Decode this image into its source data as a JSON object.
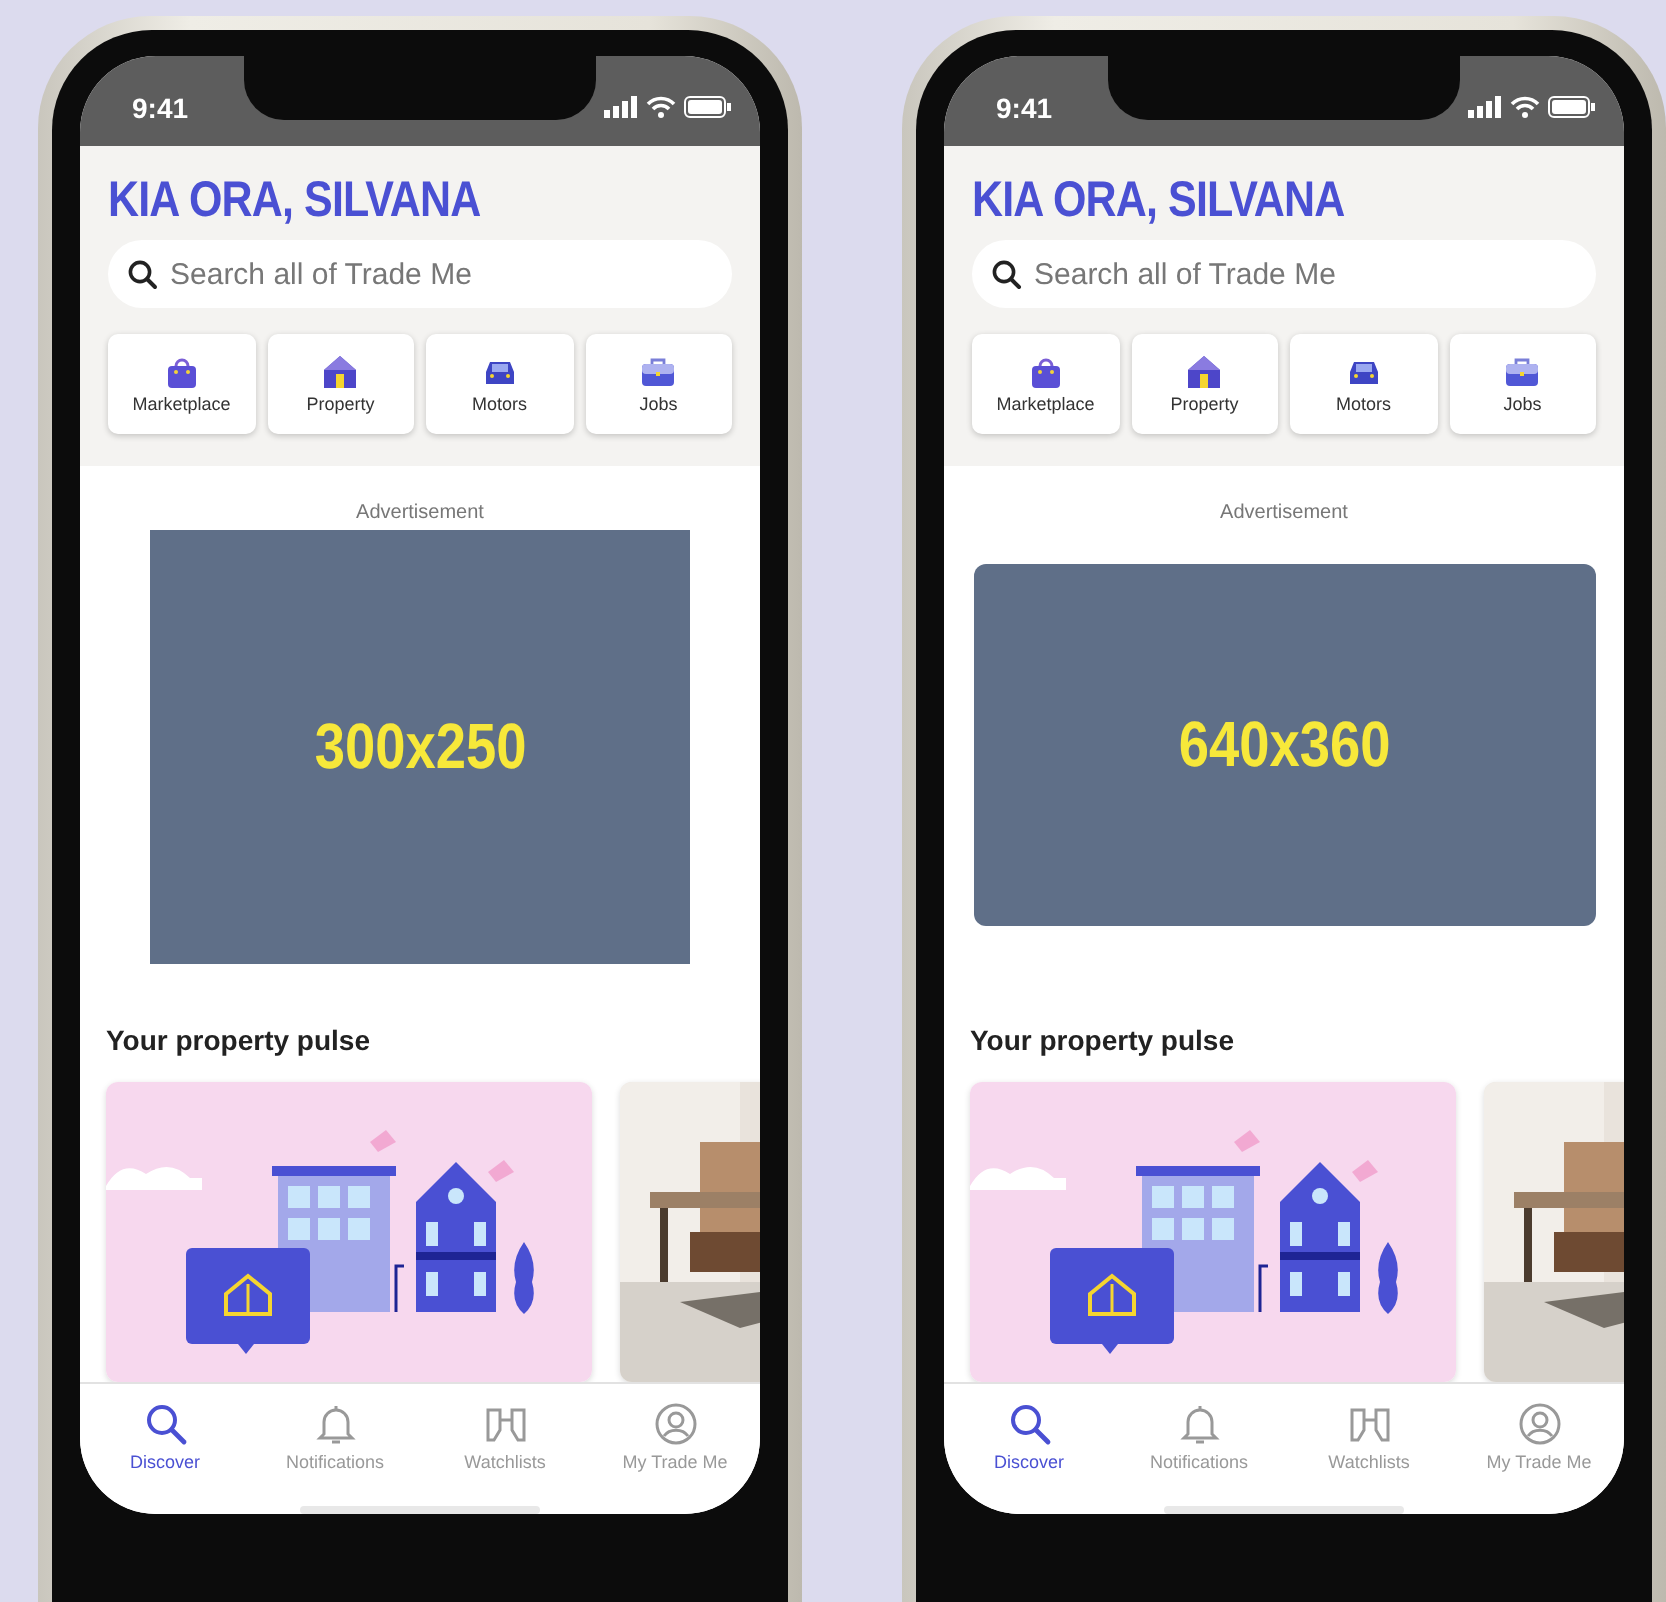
{
  "phones": [
    {
      "status_bar": {
        "time": "9:41"
      },
      "greeting": "KIA ORA, SILVANA",
      "search": {
        "placeholder": "Search all of Trade Me"
      },
      "categories": [
        {
          "label": "Marketplace",
          "kind": "bag"
        },
        {
          "label": "Property",
          "kind": "house"
        },
        {
          "label": "Motors",
          "kind": "car"
        },
        {
          "label": "Jobs",
          "kind": "briefcase"
        }
      ],
      "advert": {
        "label": "Advertisement",
        "size": "300x250",
        "kind": "square"
      },
      "section_title": "Your property pulse",
      "cards": [
        {
          "kind": "illustration"
        },
        {
          "kind": "picture"
        }
      ],
      "nav": [
        {
          "label": "Discover",
          "kind": "search",
          "selected": true
        },
        {
          "label": "Notifications",
          "kind": "bell",
          "selected": false
        },
        {
          "label": "Watchlists",
          "kind": "binoculars",
          "selected": false
        },
        {
          "label": "My Trade Me",
          "kind": "person",
          "selected": false
        }
      ]
    },
    {
      "status_bar": {
        "time": "9:41"
      },
      "greeting": "KIA ORA, SILVANA",
      "search": {
        "placeholder": "Search all of Trade Me"
      },
      "categories": [
        {
          "label": "Marketplace",
          "kind": "bag"
        },
        {
          "label": "Property",
          "kind": "house"
        },
        {
          "label": "Motors",
          "kind": "car"
        },
        {
          "label": "Jobs",
          "kind": "briefcase"
        }
      ],
      "advert": {
        "label": "Advertisement",
        "size": "640x360",
        "kind": "wide"
      },
      "section_title": "Your property pulse",
      "cards": [
        {
          "kind": "illustration"
        },
        {
          "kind": "picture"
        }
      ],
      "nav": [
        {
          "label": "Discover",
          "kind": "search",
          "selected": true
        },
        {
          "label": "Notifications",
          "kind": "bell",
          "selected": false
        },
        {
          "label": "Watchlists",
          "kind": "binoculars",
          "selected": false
        },
        {
          "label": "My Trade Me",
          "kind": "person",
          "selected": false
        }
      ]
    }
  ]
}
